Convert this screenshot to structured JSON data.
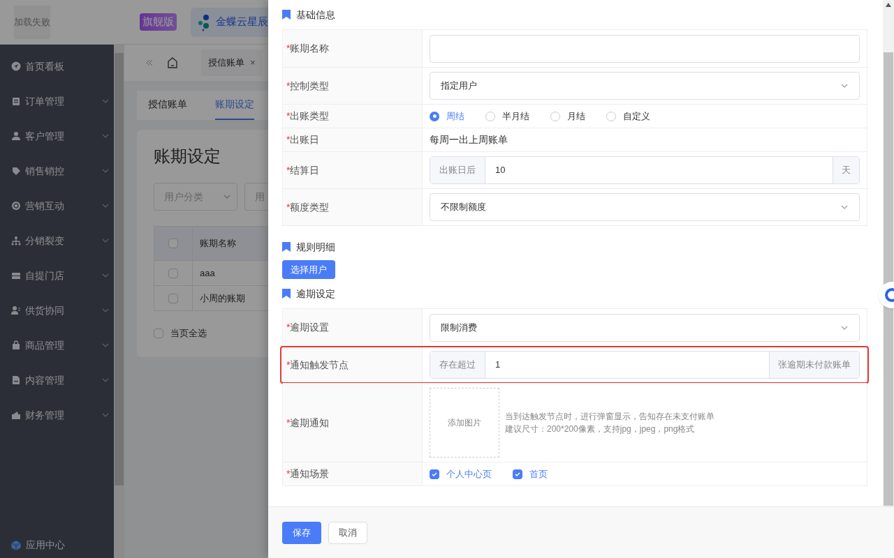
{
  "app_header": {
    "load_failed": "加载失败",
    "edition_badge": "旗舰版",
    "brand": "金蝶云星辰"
  },
  "sidebar": {
    "items": [
      {
        "label": "首页看板",
        "expandable": false
      },
      {
        "label": "订单管理",
        "expandable": true
      },
      {
        "label": "客户管理",
        "expandable": true
      },
      {
        "label": "销售销控",
        "expandable": true
      },
      {
        "label": "营销互动",
        "expandable": true
      },
      {
        "label": "分销裂变",
        "expandable": true
      },
      {
        "label": "自提门店",
        "expandable": true
      },
      {
        "label": "供货协同",
        "expandable": true
      },
      {
        "label": "商品管理",
        "expandable": true
      },
      {
        "label": "内容管理",
        "expandable": true
      },
      {
        "label": "财务管理",
        "expandable": true
      }
    ],
    "app_center": "应用中心"
  },
  "page_tabs": [
    {
      "label": "授信账单",
      "close": "×"
    }
  ],
  "sub_tabs": [
    {
      "label": "授信账单",
      "selected": false
    },
    {
      "label": "账期设定",
      "selected": true
    }
  ],
  "page_title": "账期设定",
  "filters": [
    {
      "placeholder": "用户分类"
    },
    {
      "placeholder": "用"
    }
  ],
  "table": {
    "header_checked": false,
    "columns": [
      "账期名称"
    ],
    "rows": [
      {
        "checked": false,
        "cells": [
          "aaa"
        ]
      },
      {
        "checked": false,
        "cells": [
          "小周的账期"
        ]
      }
    ]
  },
  "select_all": {
    "label": "当页全选",
    "checked": false
  },
  "drawer": {
    "sections": [
      {
        "title": "基础信息",
        "rows": [
          {
            "kind": "input",
            "mark": "*",
            "label": "账期名称"
          },
          {
            "kind": "select",
            "mark": "*",
            "label": "控制类型",
            "value": "指定用户"
          },
          {
            "kind": "radio",
            "mark": "*",
            "label": "出账类型",
            "options": [
              {
                "label": "周结",
                "selected": true
              },
              {
                "label": "半月结",
                "selected": false
              },
              {
                "label": "月结",
                "selected": false
              },
              {
                "label": "自定义",
                "selected": false
              }
            ]
          },
          {
            "kind": "text",
            "mark": "*",
            "label": "出账日",
            "value": "每周一出上周账单"
          },
          {
            "kind": "addon",
            "mark": "*",
            "label": "结算日",
            "prefix": "出账日后",
            "value": "10",
            "suffix": "天",
            "highlighted": false
          },
          {
            "kind": "select",
            "mark": "*",
            "label": "额度类型",
            "value": "不限制额度"
          }
        ]
      },
      {
        "title": "规则明细",
        "button": "选择用户"
      },
      {
        "title": "逾期设定",
        "rows": [
          {
            "kind": "select",
            "mark": "*",
            "label": "逾期设置",
            "value": "限制消费"
          },
          {
            "kind": "addon",
            "mark": "*",
            "label": "通知触发节点",
            "prefix": "存在超过",
            "value": "1",
            "suffix": "张逾期未付款账单",
            "highlighted": true
          },
          {
            "kind": "upload",
            "mark": "*",
            "label": "逾期通知",
            "upload_label": "添加图片",
            "hints": [
              "当到达触发节点时，进行弹窗显示，告知存在未支付账单",
              "建议尺寸：200*200像素，支持jpg，jpeg，png格式"
            ]
          },
          {
            "kind": "checkbox",
            "mark": "*",
            "label": "通知场景",
            "options": [
              {
                "label": "个人中心页",
                "checked": true
              },
              {
                "label": "首页",
                "checked": true
              }
            ]
          }
        ]
      }
    ],
    "buttons": [
      {
        "label": "保存",
        "kind": "primary"
      },
      {
        "label": "取消",
        "kind": "default"
      }
    ]
  }
}
